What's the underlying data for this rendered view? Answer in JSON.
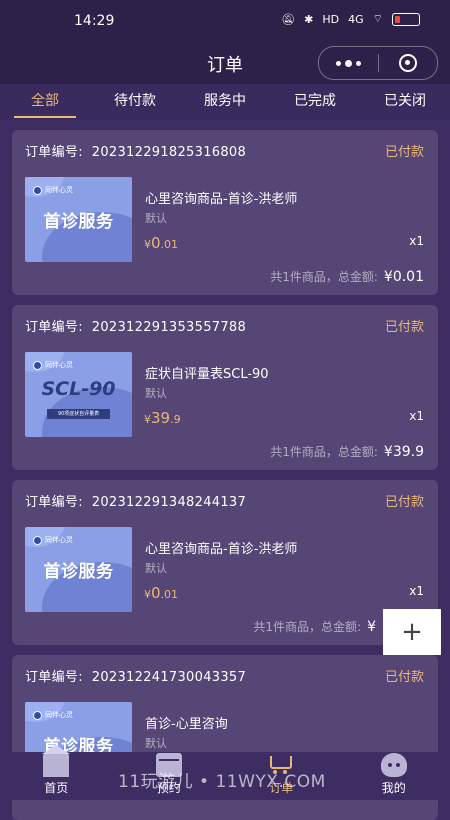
{
  "status_bar": {
    "time": "14:29",
    "icons": [
      "mute-icon",
      "bluetooth-icon",
      "hd-icon",
      "signal-icon",
      "wifi-icon",
      "battery-icon"
    ],
    "hd": "HD",
    "signal": "4G"
  },
  "navbar": {
    "title": "订单"
  },
  "tabs": [
    {
      "label": "全部",
      "active": true
    },
    {
      "label": "待付款",
      "active": false
    },
    {
      "label": "服务中",
      "active": false
    },
    {
      "label": "已完成",
      "active": false
    },
    {
      "label": "已关闭",
      "active": false
    }
  ],
  "orders": [
    {
      "order_label": "订单编号:",
      "order_no": "202312291825316808",
      "status": "已付款",
      "product_name": "心里咨询商品-首诊-洪老师",
      "spec": "默认",
      "currency": "¥",
      "price_int": "0",
      "price_dec": ".01",
      "qty": "x1",
      "summary": "共1件商品，总金额:",
      "total": "¥0.01",
      "thumb": {
        "brand": "同伴心灵",
        "title": "首诊服务"
      }
    },
    {
      "order_label": "订单编号:",
      "order_no": "202312291353557788",
      "status": "已付款",
      "product_name": "症状自评量表SCL-90",
      "spec": "默认",
      "currency": "¥",
      "price_int": "39",
      "price_dec": ".9",
      "qty": "x1",
      "summary": "共1件商品，总金额:",
      "total": "¥39.9",
      "thumb": {
        "brand": "同伴心灵",
        "title": "SCL-90",
        "tag": "90项症状自评量表"
      }
    },
    {
      "order_label": "订单编号:",
      "order_no": "202312291348244137",
      "status": "已付款",
      "product_name": "心里咨询商品-首诊-洪老师",
      "spec": "默认",
      "currency": "¥",
      "price_int": "0",
      "price_dec": ".01",
      "qty": "x1",
      "summary": "共1件商品，总金额:",
      "total": "¥",
      "thumb": {
        "brand": "同伴心灵",
        "title": "首诊服务"
      }
    },
    {
      "order_label": "订单编号:",
      "order_no": "202312241730043357",
      "status": "已付款",
      "product_name": "首诊-心里咨询",
      "spec": "默认",
      "thumb": {
        "brand": "同伴心灵",
        "title": "首诊服务"
      }
    }
  ],
  "fab": {
    "label": "+"
  },
  "tabbar": [
    {
      "label": "首页",
      "icon": "home-icon"
    },
    {
      "label": "预约",
      "icon": "calendar-icon"
    },
    {
      "label": "订单",
      "icon": "cart-icon",
      "active": true
    },
    {
      "label": "我的",
      "icon": "profile-icon"
    }
  ],
  "watermark": "11玩游儿 • 11WYX.COM",
  "colors": {
    "background": "#3d2d63",
    "card": "#564676",
    "accent": "#e7b878",
    "header": "#2e2149"
  }
}
